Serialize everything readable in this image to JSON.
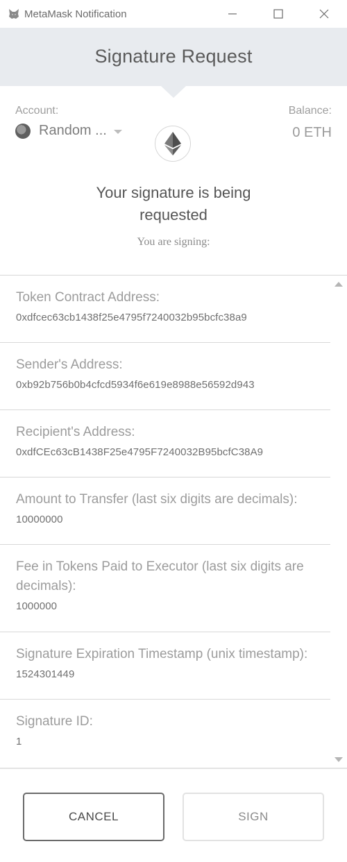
{
  "window": {
    "title": "MetaMask Notification",
    "app_icon": "metamask-fox-icon",
    "controls": [
      "minimize-icon",
      "maximize-icon",
      "close-icon"
    ]
  },
  "header": {
    "title": "Signature Request"
  },
  "account": {
    "label": "Account:",
    "name": "Random ...",
    "avatar_icon": "avatar"
  },
  "balance": {
    "label": "Balance:",
    "value": "0 ETH"
  },
  "network_icon": "ethereum-icon",
  "prompt": {
    "line1": "Your signature is being",
    "line2": "requested"
  },
  "signing_label": "You are signing:",
  "fields": [
    {
      "label": "Token Contract Address:",
      "value": "0xdfcec63cb1438f25e4795f7240032b95bcfc38a9"
    },
    {
      "label": "Sender's Address:",
      "value": "0xb92b756b0b4cfcd5934f6e619e8988e56592d943"
    },
    {
      "label": "Recipient's Address:",
      "value": "0xdfCEc63cB1438F25e4795F7240032B95bcfC38A9"
    },
    {
      "label": "Amount to Transfer (last six digits are decimals):",
      "value": "10000000"
    },
    {
      "label": "Fee in Tokens Paid to Executor (last six digits are decimals):",
      "value": "1000000"
    },
    {
      "label": "Signature Expiration Timestamp (unix timestamp):",
      "value": "1524301449"
    },
    {
      "label": "Signature ID:",
      "value": "1"
    }
  ],
  "buttons": {
    "cancel": "CANCEL",
    "sign": "SIGN"
  },
  "colors": {
    "header_bg": "#e8ebef",
    "divider": "#d8d8d8",
    "cancel_border": "#6a6a6a",
    "sign_border": "#e2e2e2"
  }
}
